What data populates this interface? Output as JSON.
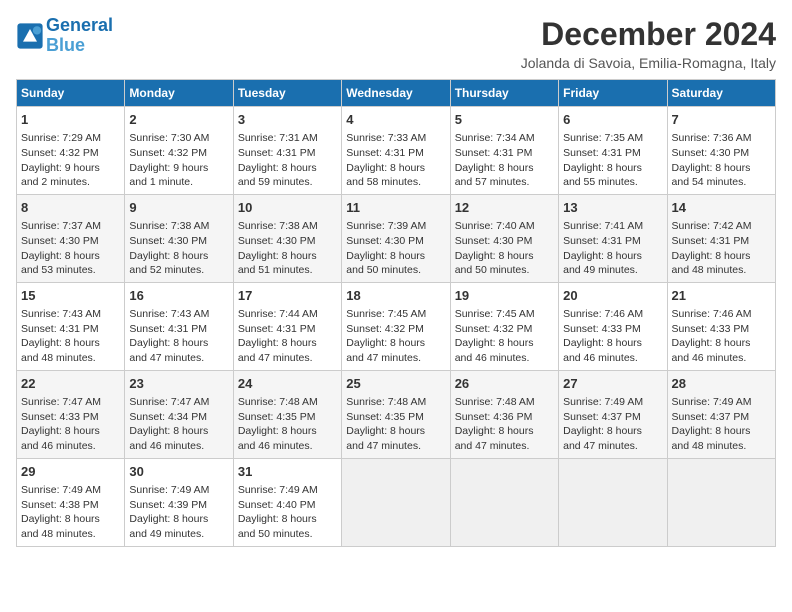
{
  "header": {
    "logo_line1": "General",
    "logo_line2": "Blue",
    "month": "December 2024",
    "location": "Jolanda di Savoia, Emilia-Romagna, Italy"
  },
  "columns": [
    "Sunday",
    "Monday",
    "Tuesday",
    "Wednesday",
    "Thursday",
    "Friday",
    "Saturday"
  ],
  "weeks": [
    [
      {
        "day": "1",
        "info": "Sunrise: 7:29 AM\nSunset: 4:32 PM\nDaylight: 9 hours\nand 2 minutes."
      },
      {
        "day": "2",
        "info": "Sunrise: 7:30 AM\nSunset: 4:32 PM\nDaylight: 9 hours\nand 1 minute."
      },
      {
        "day": "3",
        "info": "Sunrise: 7:31 AM\nSunset: 4:31 PM\nDaylight: 8 hours\nand 59 minutes."
      },
      {
        "day": "4",
        "info": "Sunrise: 7:33 AM\nSunset: 4:31 PM\nDaylight: 8 hours\nand 58 minutes."
      },
      {
        "day": "5",
        "info": "Sunrise: 7:34 AM\nSunset: 4:31 PM\nDaylight: 8 hours\nand 57 minutes."
      },
      {
        "day": "6",
        "info": "Sunrise: 7:35 AM\nSunset: 4:31 PM\nDaylight: 8 hours\nand 55 minutes."
      },
      {
        "day": "7",
        "info": "Sunrise: 7:36 AM\nSunset: 4:30 PM\nDaylight: 8 hours\nand 54 minutes."
      }
    ],
    [
      {
        "day": "8",
        "info": "Sunrise: 7:37 AM\nSunset: 4:30 PM\nDaylight: 8 hours\nand 53 minutes."
      },
      {
        "day": "9",
        "info": "Sunrise: 7:38 AM\nSunset: 4:30 PM\nDaylight: 8 hours\nand 52 minutes."
      },
      {
        "day": "10",
        "info": "Sunrise: 7:38 AM\nSunset: 4:30 PM\nDaylight: 8 hours\nand 51 minutes."
      },
      {
        "day": "11",
        "info": "Sunrise: 7:39 AM\nSunset: 4:30 PM\nDaylight: 8 hours\nand 50 minutes."
      },
      {
        "day": "12",
        "info": "Sunrise: 7:40 AM\nSunset: 4:30 PM\nDaylight: 8 hours\nand 50 minutes."
      },
      {
        "day": "13",
        "info": "Sunrise: 7:41 AM\nSunset: 4:31 PM\nDaylight: 8 hours\nand 49 minutes."
      },
      {
        "day": "14",
        "info": "Sunrise: 7:42 AM\nSunset: 4:31 PM\nDaylight: 8 hours\nand 48 minutes."
      }
    ],
    [
      {
        "day": "15",
        "info": "Sunrise: 7:43 AM\nSunset: 4:31 PM\nDaylight: 8 hours\nand 48 minutes."
      },
      {
        "day": "16",
        "info": "Sunrise: 7:43 AM\nSunset: 4:31 PM\nDaylight: 8 hours\nand 47 minutes."
      },
      {
        "day": "17",
        "info": "Sunrise: 7:44 AM\nSunset: 4:31 PM\nDaylight: 8 hours\nand 47 minutes."
      },
      {
        "day": "18",
        "info": "Sunrise: 7:45 AM\nSunset: 4:32 PM\nDaylight: 8 hours\nand 47 minutes."
      },
      {
        "day": "19",
        "info": "Sunrise: 7:45 AM\nSunset: 4:32 PM\nDaylight: 8 hours\nand 46 minutes."
      },
      {
        "day": "20",
        "info": "Sunrise: 7:46 AM\nSunset: 4:33 PM\nDaylight: 8 hours\nand 46 minutes."
      },
      {
        "day": "21",
        "info": "Sunrise: 7:46 AM\nSunset: 4:33 PM\nDaylight: 8 hours\nand 46 minutes."
      }
    ],
    [
      {
        "day": "22",
        "info": "Sunrise: 7:47 AM\nSunset: 4:33 PM\nDaylight: 8 hours\nand 46 minutes."
      },
      {
        "day": "23",
        "info": "Sunrise: 7:47 AM\nSunset: 4:34 PM\nDaylight: 8 hours\nand 46 minutes."
      },
      {
        "day": "24",
        "info": "Sunrise: 7:48 AM\nSunset: 4:35 PM\nDaylight: 8 hours\nand 46 minutes."
      },
      {
        "day": "25",
        "info": "Sunrise: 7:48 AM\nSunset: 4:35 PM\nDaylight: 8 hours\nand 47 minutes."
      },
      {
        "day": "26",
        "info": "Sunrise: 7:48 AM\nSunset: 4:36 PM\nDaylight: 8 hours\nand 47 minutes."
      },
      {
        "day": "27",
        "info": "Sunrise: 7:49 AM\nSunset: 4:37 PM\nDaylight: 8 hours\nand 47 minutes."
      },
      {
        "day": "28",
        "info": "Sunrise: 7:49 AM\nSunset: 4:37 PM\nDaylight: 8 hours\nand 48 minutes."
      }
    ],
    [
      {
        "day": "29",
        "info": "Sunrise: 7:49 AM\nSunset: 4:38 PM\nDaylight: 8 hours\nand 48 minutes."
      },
      {
        "day": "30",
        "info": "Sunrise: 7:49 AM\nSunset: 4:39 PM\nDaylight: 8 hours\nand 49 minutes."
      },
      {
        "day": "31",
        "info": "Sunrise: 7:49 AM\nSunset: 4:40 PM\nDaylight: 8 hours\nand 50 minutes."
      },
      {
        "day": "",
        "info": ""
      },
      {
        "day": "",
        "info": ""
      },
      {
        "day": "",
        "info": ""
      },
      {
        "day": "",
        "info": ""
      }
    ]
  ]
}
